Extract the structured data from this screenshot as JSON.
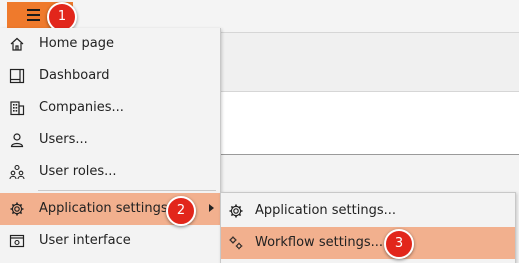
{
  "hamburger": {
    "icon": "hamburger-menu-icon"
  },
  "badges": [
    "1",
    "2",
    "3"
  ],
  "menu": {
    "items": [
      {
        "label": "Home page",
        "icon": "home-icon"
      },
      {
        "label": "Dashboard",
        "icon": "dashboard-icon"
      },
      {
        "label": "Companies...",
        "icon": "building-icon"
      },
      {
        "label": "Users...",
        "icon": "user-icon"
      },
      {
        "label": "User roles...",
        "icon": "user-roles-icon"
      },
      {
        "label": "Application settings",
        "icon": "gear-icon",
        "highlighted": true
      },
      {
        "label": "User interface",
        "icon": "user-interface-icon"
      }
    ]
  },
  "submenu": {
    "items": [
      {
        "label": "Application settings...",
        "icon": "gear-icon"
      },
      {
        "label": "Workflow settings...",
        "icon": "workflow-icon",
        "highlighted": true
      }
    ]
  },
  "colors": {
    "accent_orange": "#ef7a2c",
    "highlight": "#f2b08e",
    "badge_red": "#e2261b",
    "menu_bg": "#f3f3f3"
  }
}
